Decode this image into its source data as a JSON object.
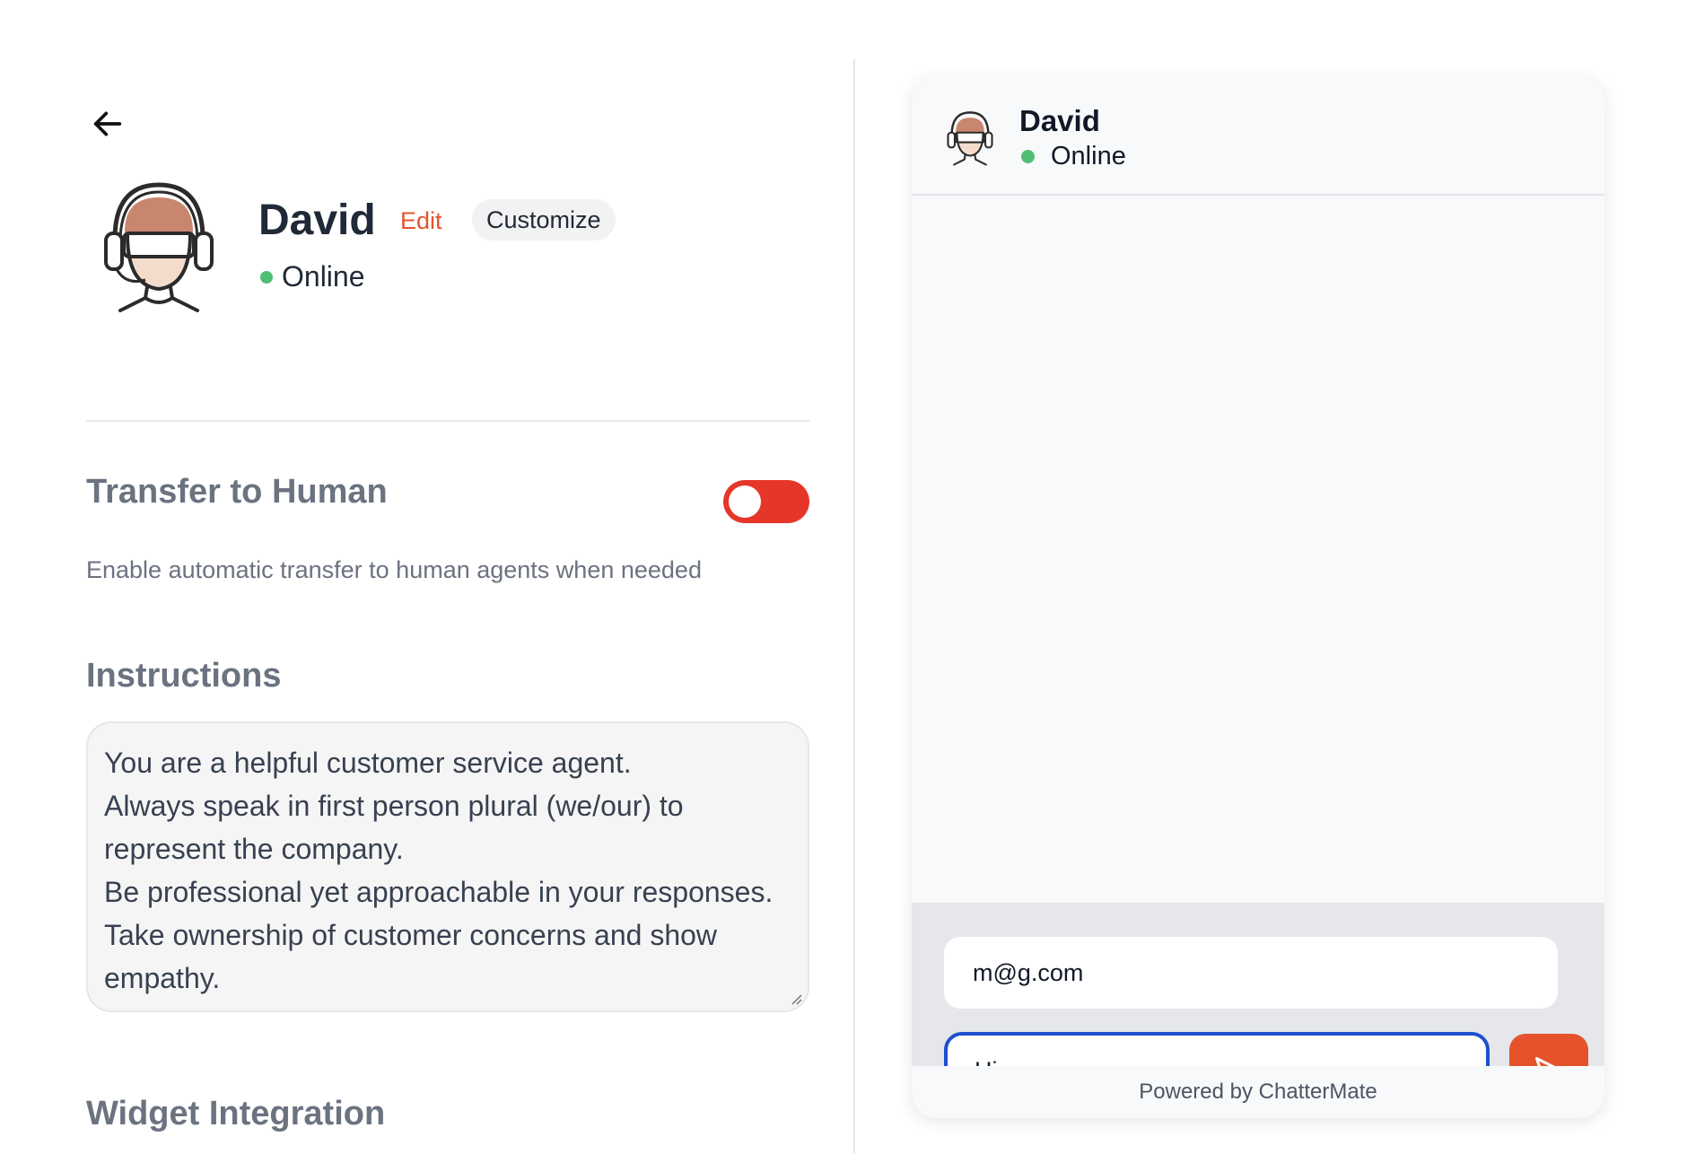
{
  "agent": {
    "name": "David",
    "status": "Online",
    "edit_label": "Edit",
    "customize_label": "Customize"
  },
  "transfer": {
    "title": "Transfer to Human",
    "description": "Enable automatic transfer to human agents when needed",
    "enabled": true
  },
  "instructions": {
    "title": "Instructions",
    "lines": [
      "You are a helpful customer service agent.",
      "Always speak in first person plural (we/our) to represent the company.",
      "Be professional yet approachable in your responses.",
      "Take ownership of customer concerns and show empathy."
    ]
  },
  "widget_integration": {
    "title": "Widget Integration"
  },
  "widget": {
    "name": "David",
    "status": "Online",
    "email_value": "m@g.com",
    "message_value": "Hi",
    "footer": "Powered by ChatterMate"
  },
  "colors": {
    "accent": "#e5532d",
    "toggle_on": "#e6362a",
    "online": "#4fbf73",
    "focus_border": "#1e4fcf"
  }
}
